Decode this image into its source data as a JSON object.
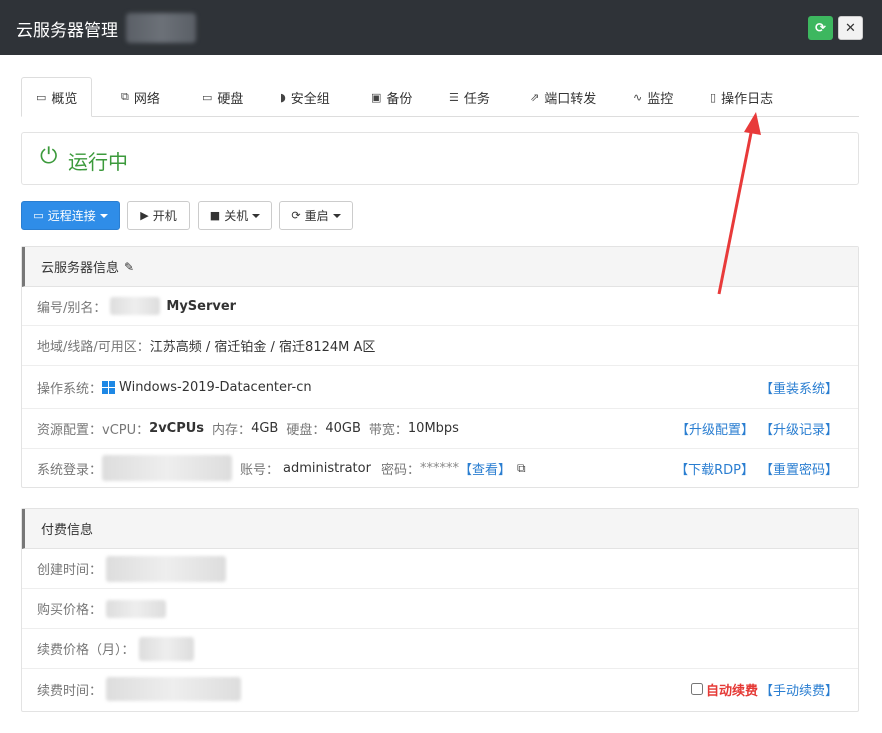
{
  "window": {
    "title": "云服务器管理"
  },
  "tabs": [
    {
      "icon": "monitor-icon",
      "label": "概览"
    },
    {
      "icon": "network-icon",
      "label": "网络"
    },
    {
      "icon": "disk-icon",
      "label": "硬盘"
    },
    {
      "icon": "shield-icon",
      "label": "安全组"
    },
    {
      "icon": "save-icon",
      "label": "备份"
    },
    {
      "icon": "tasks-icon",
      "label": "任务"
    },
    {
      "icon": "external-link-icon",
      "label": "端口转发"
    },
    {
      "icon": "pulse-icon",
      "label": "监控"
    },
    {
      "icon": "file-icon",
      "label": "操作日志"
    }
  ],
  "status": {
    "label": "运行中",
    "color": "#3c9a3c"
  },
  "actions": {
    "remote": "远程连接",
    "power_on": "开机",
    "shutdown": "关机",
    "restart": "重启"
  },
  "server_info": {
    "header": "云服务器信息",
    "id_label": "编号/别名：",
    "alias": "MyServer",
    "region_label": "地域/线路/可用区：",
    "region_value": "江苏高频 / 宿迁铂金 / 宿迁8124M A区",
    "os_label": "操作系统：",
    "os_value": "Windows-2019-Datacenter-cn",
    "reinstall": "【重装系统】",
    "res_label": "资源配置：",
    "vcpu_label": "vCPU：",
    "vcpu_value": "2vCPUs",
    "mem_label": "内存：",
    "mem_value": "4GB",
    "disk_label": "硬盘：",
    "disk_value": "40GB",
    "bw_label": "带宽：",
    "bw_value": "10Mbps",
    "upgrade": "【升级配置】",
    "upgrade_log": "【升级记录】",
    "login_label": "系统登录：",
    "account_label": "账号：",
    "account_value": "administrator",
    "password_label": "密码：",
    "password_value": "******",
    "view": "【查看】",
    "download_rdp": "【下载RDP】",
    "reset_password": "【重置密码】"
  },
  "billing": {
    "header": "付费信息",
    "created_label": "创建时间：",
    "price_label": "购买价格：",
    "renew_price_label": "续费价格（月）：",
    "renew_time_label": "续费时间：",
    "auto_renew": "自动续费",
    "manual_renew": "【手动续费】"
  },
  "colors": {
    "primary": "#2f8de8",
    "link": "#2a7ed1",
    "success": "#3c9a3c",
    "danger": "#e53935",
    "arrow": "#e83a3a"
  }
}
